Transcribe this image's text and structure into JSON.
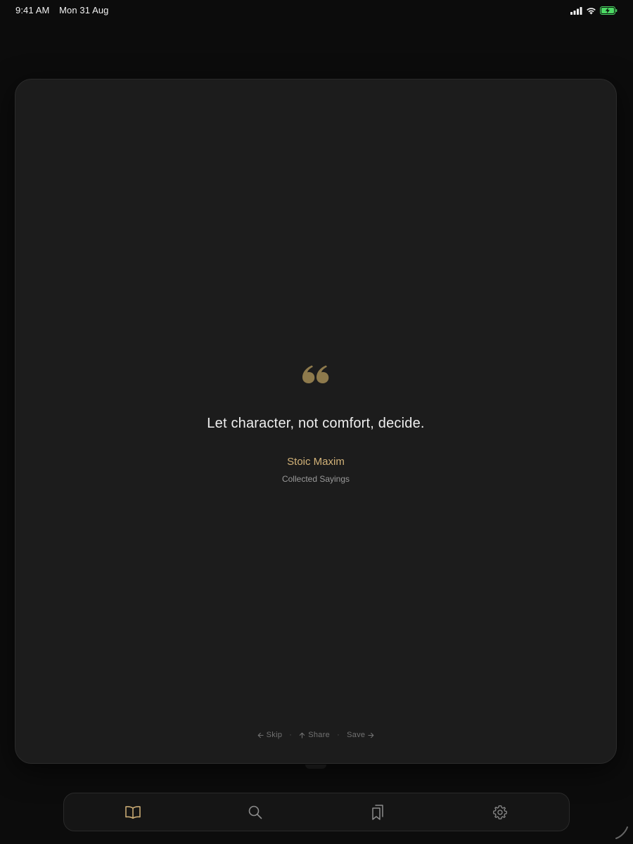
{
  "status_bar": {
    "time": "9:41 AM",
    "date": "Mon 31 Aug",
    "icons": [
      "signal-icon",
      "wifi-icon",
      "battery-charging-icon"
    ]
  },
  "quote": {
    "icon": "quote-mark-icon",
    "text": "Let character, not comfort, decide.",
    "author": "Stoic Maxim",
    "source": "Collected Sayings"
  },
  "actions": {
    "skip": "Skip",
    "share": "Share",
    "save": "Save"
  },
  "tabs": [
    {
      "icon": "book-icon",
      "active": true
    },
    {
      "icon": "search-icon",
      "active": false
    },
    {
      "icon": "bookmarks-icon",
      "active": false
    },
    {
      "icon": "gear-icon",
      "active": false
    }
  ],
  "colors": {
    "background": "#0c0c0c",
    "card": "#1c1c1c",
    "accent": "#d2b278",
    "quote_mark": "#8e7a4c",
    "muted_text": "#9a9a9a",
    "battery": "#4cd964"
  }
}
